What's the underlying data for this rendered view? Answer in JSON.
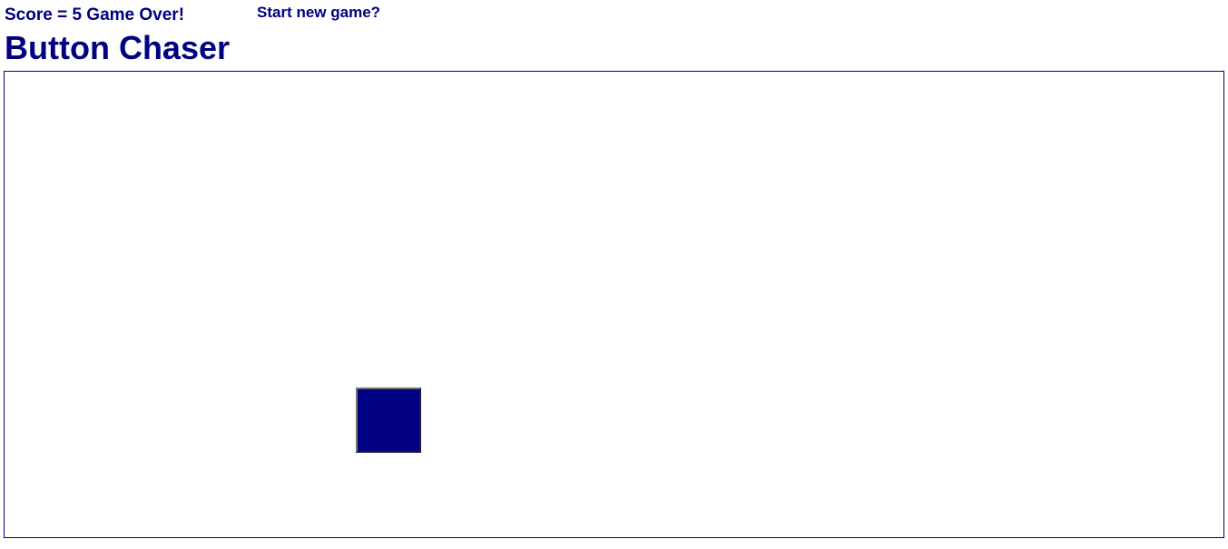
{
  "header": {
    "score_text": "Score = 5 Game Over!",
    "restart_label": "Start new game?",
    "title": "Button Chaser"
  },
  "game": {
    "score": 5,
    "status": "Game Over",
    "button_color": "#000080"
  },
  "colors": {
    "text": "#000080",
    "arena_border": "#000080",
    "background": "#ffffff"
  }
}
